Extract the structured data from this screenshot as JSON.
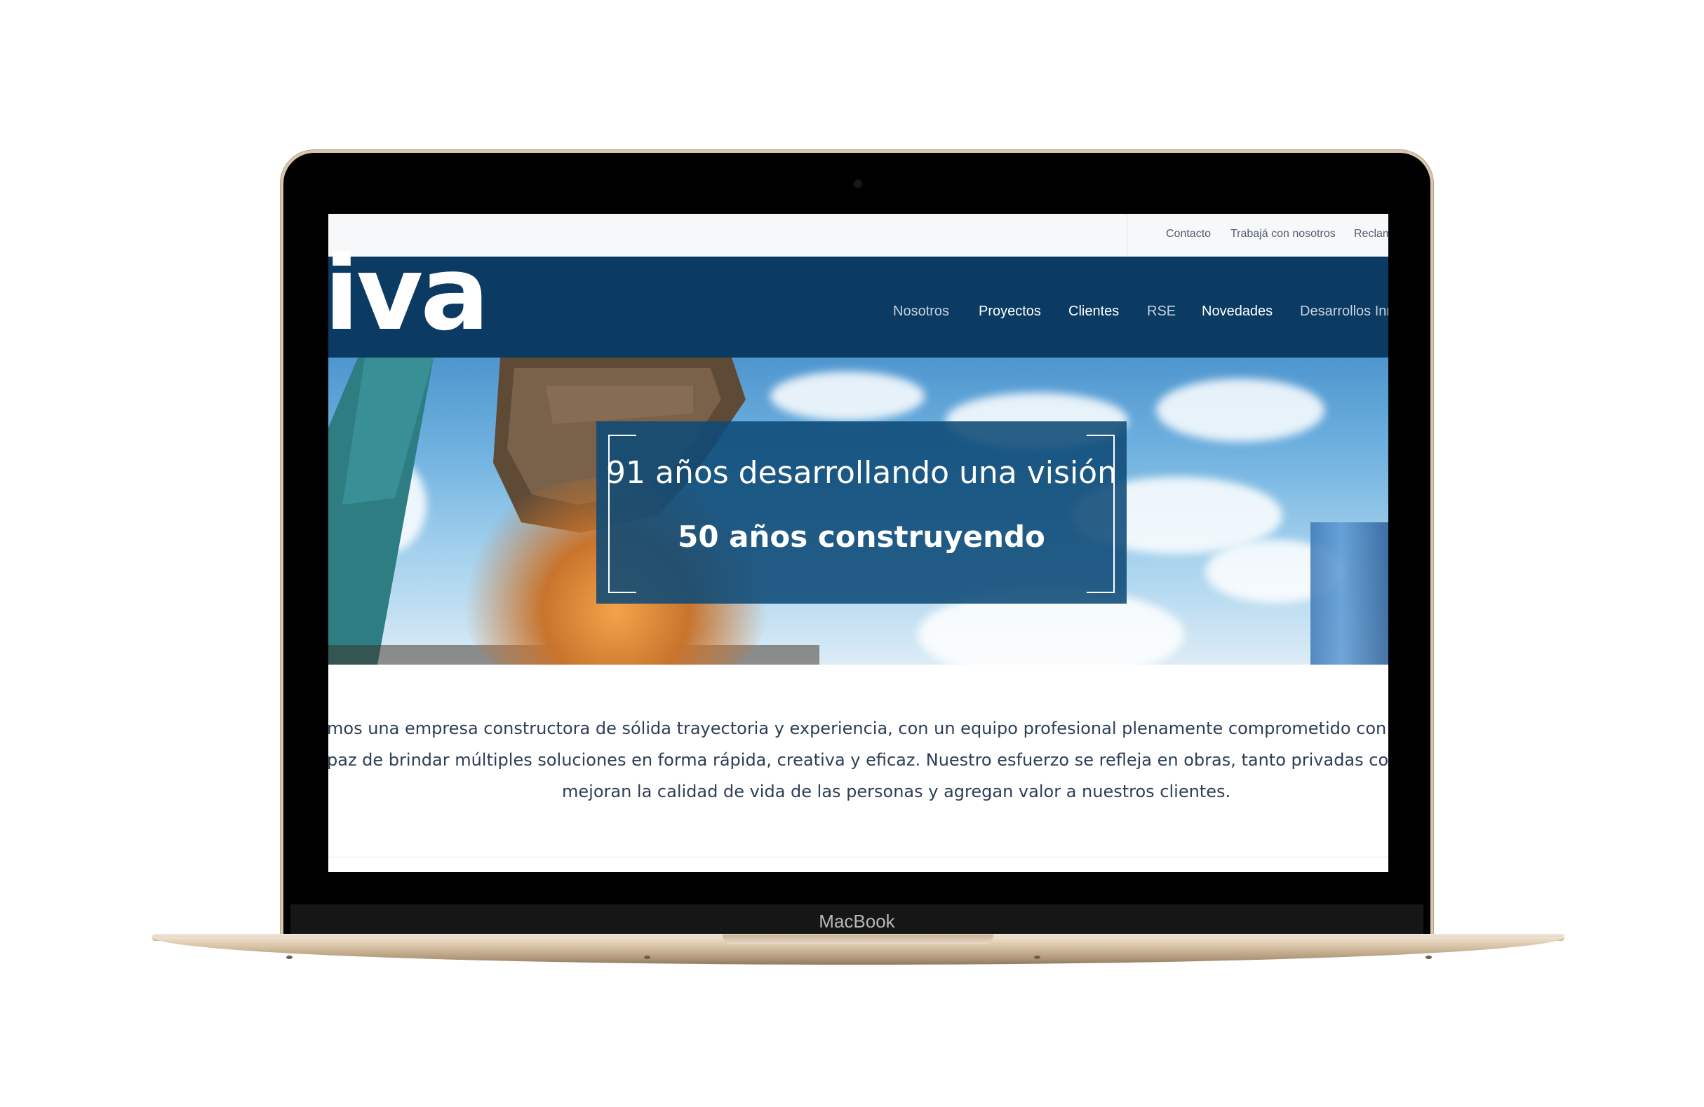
{
  "device": {
    "label": "MacBook"
  },
  "utility_nav": [
    "Contacto",
    "Trabajá con nosotros",
    "Reclam"
  ],
  "brand": {
    "logo_text": "iva"
  },
  "main_nav": [
    {
      "label": "Nosotros"
    },
    {
      "label": "Proyectos"
    },
    {
      "label": "Clientes"
    },
    {
      "label": "RSE"
    },
    {
      "label": "Novedades"
    },
    {
      "label": "Desarrollos Inr"
    }
  ],
  "hero": {
    "line1": "91 años desarrollando una visión",
    "line2": "50 años construyendo"
  },
  "intro": {
    "line1": "mos una empresa constructora de sólida trayectoria y experiencia, con un equipo profesional plenamente comprometido con el cumplimien",
    "line2": "paz de brindar múltiples soluciones en forma rápida, creativa y eficaz. Nuestro esfuerzo se refleja en obras, tanto privadas como públicas, q",
    "line3": "mejoran la calidad de vida de las personas y agregan valor a nuestros clientes."
  },
  "colors": {
    "nav_background": "#0b3a63",
    "overlay": "#0e4a76",
    "body_text": "#2d3f56",
    "device_finish": "#d9c6ad"
  }
}
